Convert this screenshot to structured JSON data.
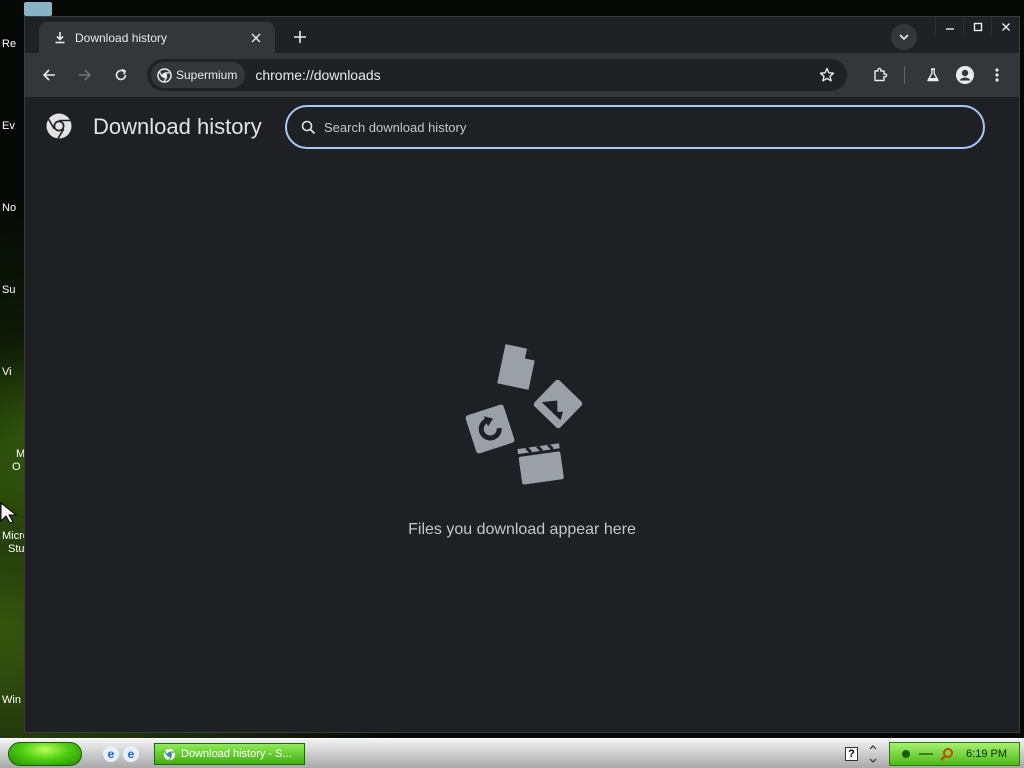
{
  "desktop": {
    "labels": [
      "Re",
      "Ev",
      "No",
      "Su",
      "Vi",
      "M",
      "O",
      "Micro",
      "Stu",
      "Win"
    ]
  },
  "window": {
    "tab": {
      "title": "Download history",
      "icon": "download-icon"
    },
    "controls": {
      "minimize": "minimize-icon",
      "maximize": "maximize-icon",
      "close": "close-icon"
    }
  },
  "toolbar": {
    "site_chip_label": "Supermium",
    "url_scheme": "chrome://",
    "url_host": "downloads"
  },
  "page": {
    "title": "Download history",
    "search": {
      "placeholder": "Search download history",
      "value": ""
    },
    "empty_message": "Files you download appear here"
  },
  "taskbar": {
    "task_label": "Download history - S...",
    "help_glyph": "?",
    "clock": "6:19 PM",
    "quicklaunch_glyph": "e"
  },
  "colors": {
    "window_bg": "#1f2023",
    "toolbar_bg": "#35363a",
    "titlebar_bg": "#202124",
    "search_border": "#a8c7fa",
    "taskbar_green": "#3fae10"
  }
}
